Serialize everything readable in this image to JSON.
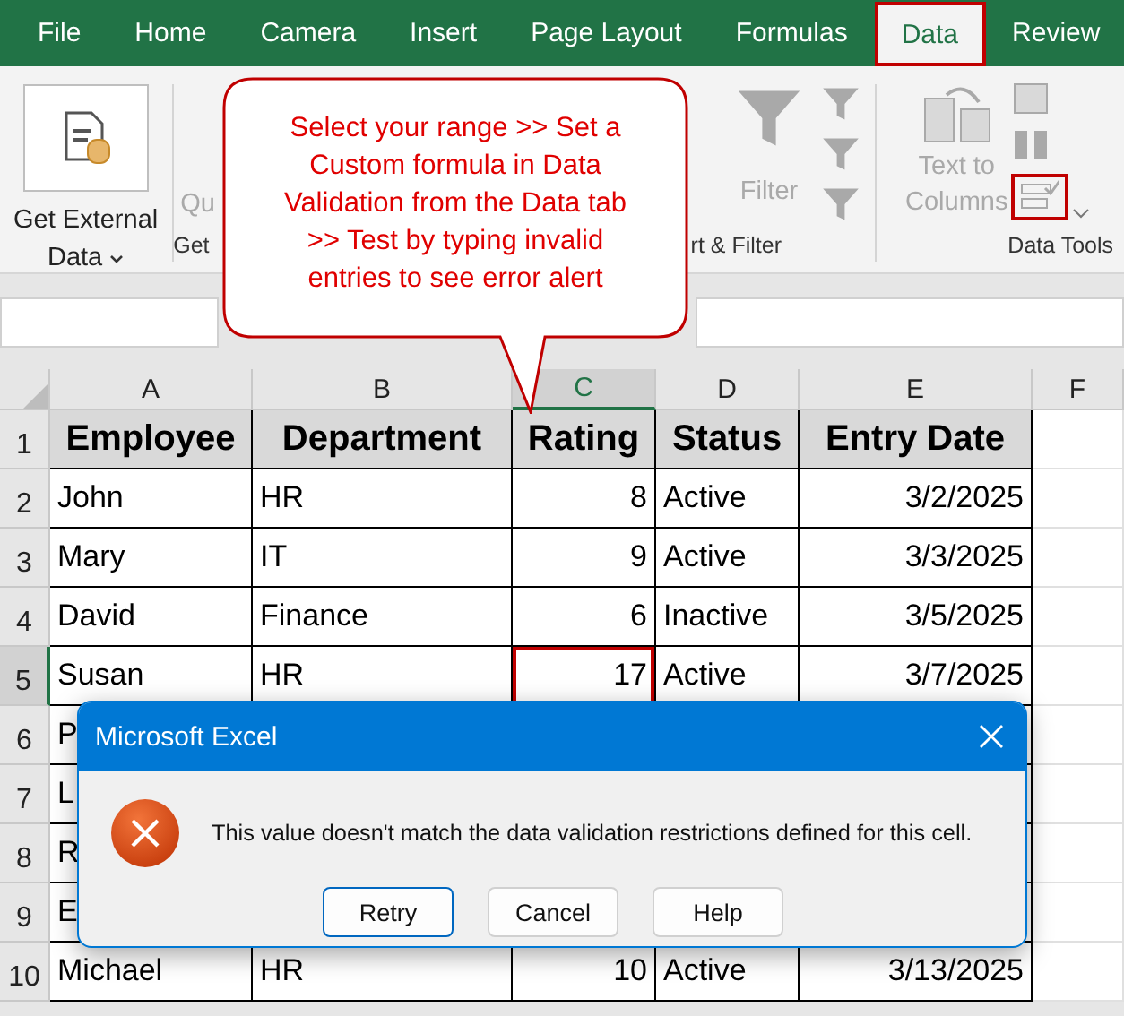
{
  "ribbon_tabs": [
    {
      "label": "File",
      "selected": false
    },
    {
      "label": "Home",
      "selected": false
    },
    {
      "label": "Camera",
      "selected": false
    },
    {
      "label": "Insert",
      "selected": false
    },
    {
      "label": "Page Layout",
      "selected": false
    },
    {
      "label": "Formulas",
      "selected": false
    },
    {
      "label": "Data",
      "selected": true
    },
    {
      "label": "Review",
      "selected": false
    }
  ],
  "ribbon": {
    "get_external_data": [
      "Get External",
      "Data"
    ],
    "queries_fragment": "Qu",
    "group_labels": [
      "Get",
      "rt & Filter",
      "Data Tools"
    ],
    "filter": "Filter",
    "text_to_columns": [
      "Text to",
      "Columns"
    ],
    "data_validation_highlighted": true
  },
  "callout": {
    "lines": [
      "Select your range >> Set a",
      "Custom formula in Data",
      "Validation from the Data tab",
      ">> Test by typing invalid",
      "entries to see error alert"
    ]
  },
  "columns": [
    {
      "label": "A",
      "kind": "text",
      "selected": false
    },
    {
      "label": "B",
      "kind": "text",
      "selected": false
    },
    {
      "label": "C",
      "kind": "number",
      "selected": true
    },
    {
      "label": "D",
      "kind": "text",
      "selected": false
    },
    {
      "label": "E",
      "kind": "number",
      "selected": false
    },
    {
      "label": "F",
      "kind": "empty",
      "selected": false
    }
  ],
  "rows": [
    {
      "number": "1",
      "kind": "header",
      "selected": false,
      "cells": [
        "Employee",
        "Department",
        "Rating",
        "Status",
        "Entry Date"
      ]
    },
    {
      "number": "2",
      "kind": "data",
      "selected": false,
      "cells": [
        "John",
        "HR",
        "8",
        "Active",
        "3/2/2025"
      ]
    },
    {
      "number": "3",
      "kind": "data",
      "selected": false,
      "cells": [
        "Mary",
        "IT",
        "9",
        "Active",
        "3/3/2025"
      ]
    },
    {
      "number": "4",
      "kind": "data",
      "selected": false,
      "cells": [
        "David",
        "Finance",
        "6",
        "Inactive",
        "3/5/2025"
      ]
    },
    {
      "number": "5",
      "kind": "data",
      "selected": true,
      "cells": [
        "Susan",
        "HR",
        "17",
        "Active",
        "3/7/2025"
      ]
    },
    {
      "number": "6",
      "kind": "data",
      "selected": false,
      "cells": [
        "P"
      ]
    },
    {
      "number": "7",
      "kind": "data",
      "selected": false,
      "cells": [
        "L"
      ]
    },
    {
      "number": "8",
      "kind": "data",
      "selected": false,
      "cells": [
        "R"
      ]
    },
    {
      "number": "9",
      "kind": "data",
      "selected": false,
      "cells": [
        "E"
      ]
    },
    {
      "number": "10",
      "kind": "data",
      "selected": false,
      "cells": [
        "Michael",
        "HR",
        "10",
        "Active",
        "3/13/2025"
      ]
    }
  ],
  "dialog": {
    "title": "Microsoft Excel",
    "message": "This value doesn't match the data validation restrictions defined for this cell.",
    "buttons": [
      {
        "label": "Retry",
        "default": true
      },
      {
        "label": "Cancel",
        "default": false
      },
      {
        "label": "Help",
        "default": false
      }
    ]
  }
}
